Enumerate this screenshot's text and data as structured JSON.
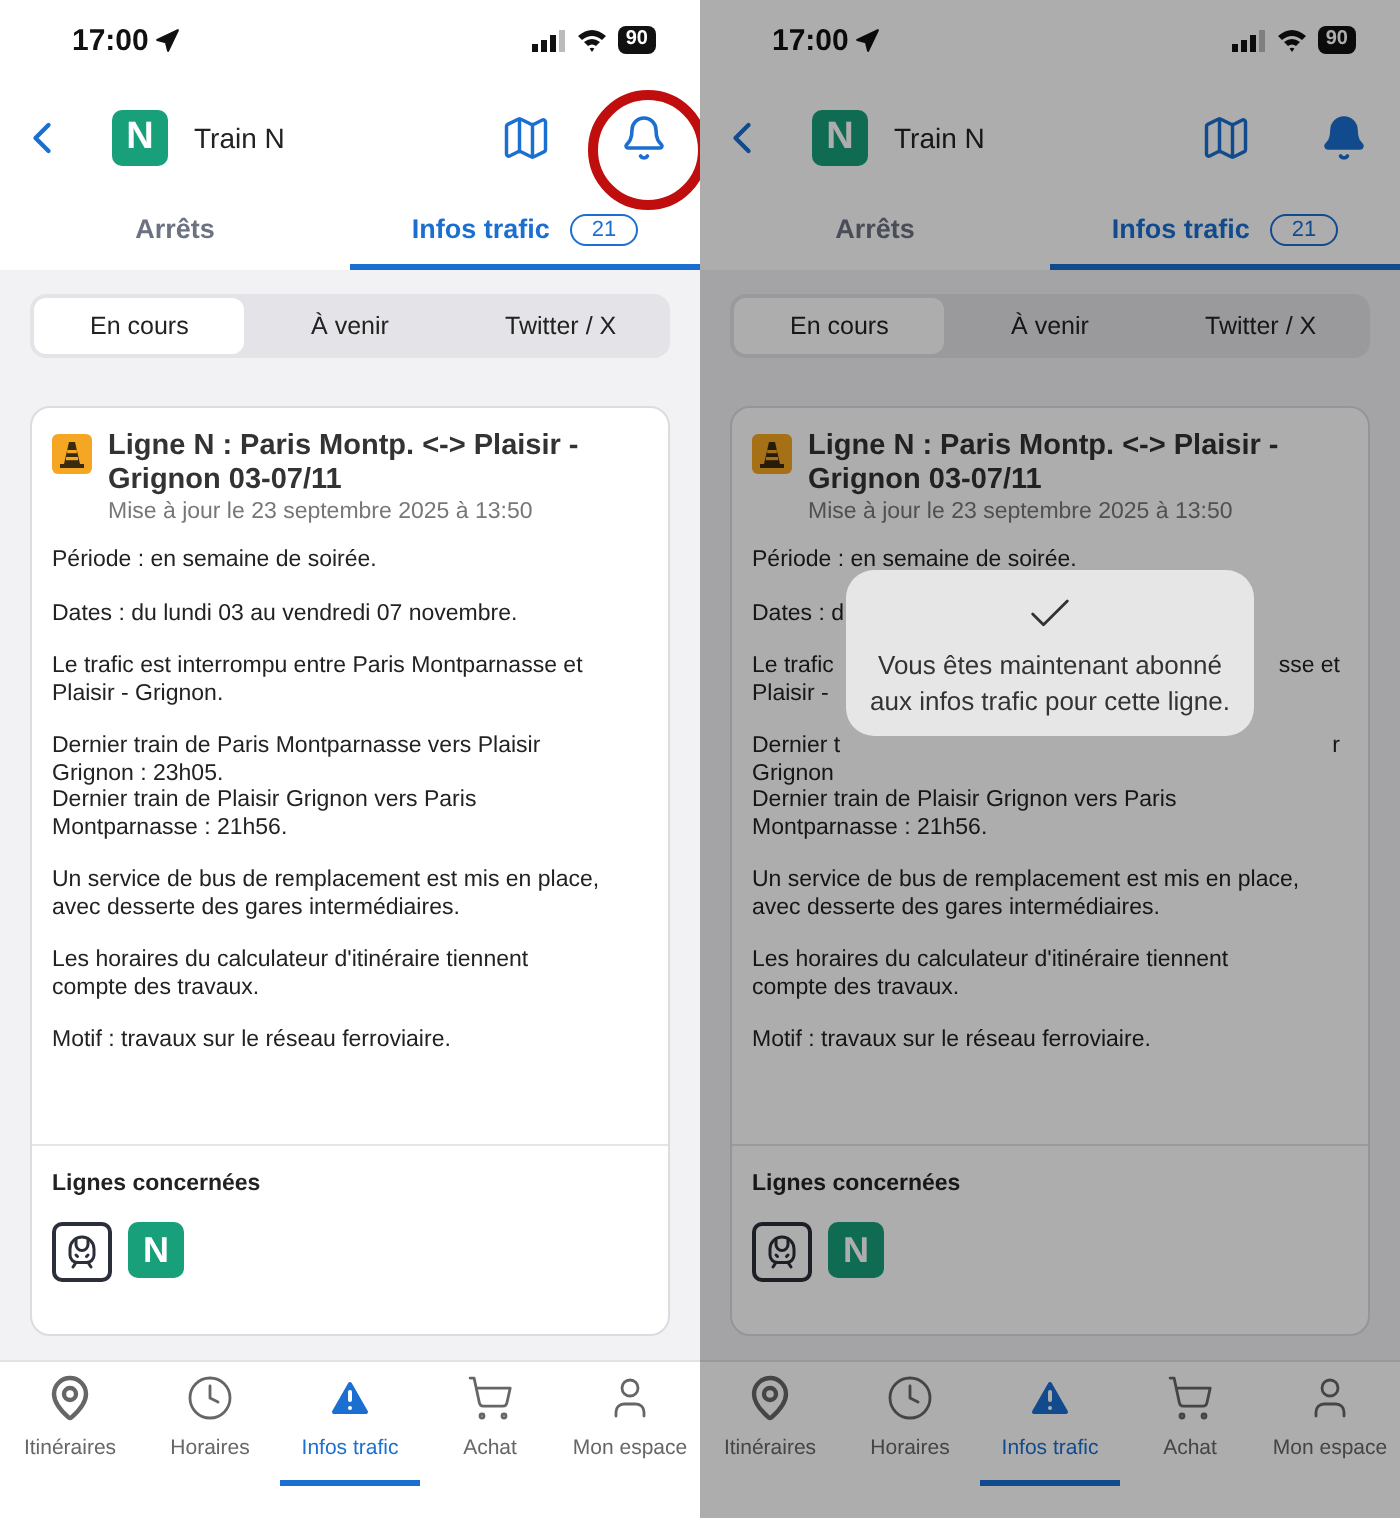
{
  "screens": [
    {
      "status_bar": {
        "time": "17:00",
        "battery": "90"
      },
      "header": {
        "line_badge": "N",
        "title": "Train N",
        "notifications_on": false,
        "highlighted": true
      },
      "tabs": [
        {
          "label": "Arrêts",
          "selected": false
        },
        {
          "label": "Infos trafic",
          "count": "21",
          "selected": true
        }
      ],
      "segments": [
        {
          "label": "En cours",
          "selected": true
        },
        {
          "label": "À venir",
          "selected": false
        },
        {
          "label": "Twitter / X",
          "selected": false
        }
      ],
      "alert": {
        "title": "Ligne N : Paris Montp. <-> Plaisir - Grignon 03-07/11",
        "updated": "Mise à jour le 23 septembre 2025 à 13:50",
        "paragraphs": [
          [
            {
              "kind": "full",
              "text": "Période : en semaine de soirée."
            }
          ],
          [
            {
              "kind": "full",
              "text": "Dates : du lundi 03 au vendredi 07 novembre."
            }
          ],
          [
            {
              "kind": "full",
              "text": "Le trafic est interrompu entre Paris Montparnasse et"
            },
            {
              "kind": "full",
              "text": "Plaisir - Grignon."
            }
          ],
          [
            {
              "kind": "full",
              "text": "Dernier train de Paris Montparnasse vers Plaisir"
            },
            {
              "kind": "full",
              "text": "Grignon : 23h05."
            },
            {
              "kind": "full",
              "text": "Dernier train de Plaisir Grignon vers Paris"
            },
            {
              "kind": "full",
              "text": "Montparnasse : 21h56."
            }
          ],
          [
            {
              "kind": "full",
              "text": "Un service de bus de remplacement est mis en place,"
            },
            {
              "kind": "full",
              "text": "avec desserte des gares intermédiaires."
            }
          ],
          [
            {
              "kind": "full",
              "text": "Les horaires du calculateur d'itinéraire tiennent"
            },
            {
              "kind": "full",
              "text": "compte des travaux."
            }
          ],
          [
            {
              "kind": "full",
              "text": "Motif : travaux sur le réseau ferroviaire."
            }
          ]
        ],
        "lines_heading": "Lignes concernées",
        "line_badges": [
          {
            "kind": "train"
          },
          {
            "kind": "line",
            "label": "N"
          }
        ]
      },
      "bottom_nav": [
        {
          "kind": "route",
          "label": "Itinéraires",
          "selected": false
        },
        {
          "kind": "clock",
          "label": "Horaires",
          "selected": false
        },
        {
          "kind": "alert",
          "label": "Infos trafic",
          "selected": true
        },
        {
          "kind": "cart",
          "label": "Achat",
          "selected": false
        },
        {
          "kind": "person",
          "label": "Mon espace",
          "selected": false
        }
      ]
    },
    {
      "status_bar": {
        "time": "17:00",
        "battery": "90"
      },
      "header": {
        "line_badge": "N",
        "title": "Train N",
        "notifications_on": true,
        "highlighted": false
      },
      "tabs": [
        {
          "label": "Arrêts",
          "selected": false
        },
        {
          "label": "Infos trafic",
          "count": "21",
          "selected": true
        }
      ],
      "segments": [
        {
          "label": "En cours",
          "selected": true
        },
        {
          "label": "À venir",
          "selected": false
        },
        {
          "label": "Twitter / X",
          "selected": false
        }
      ],
      "alert": {
        "title": "Ligne N : Paris Montp. <-> Plaisir - Grignon 03-07/11",
        "updated": "Mise à jour le 23 septembre 2025 à 13:50",
        "paragraphs": [
          [
            {
              "kind": "full",
              "text": "Période : en semaine de soirée."
            }
          ],
          [
            {
              "kind": "split",
              "left": "Dates : d"
            }
          ],
          [
            {
              "kind": "split",
              "left": "Le trafic",
              "right": "sse et"
            },
            {
              "kind": "split",
              "left": "Plaisir -"
            }
          ],
          [
            {
              "kind": "split",
              "left": "Dernier t",
              "right": "r"
            },
            {
              "kind": "full",
              "text": "Grignon"
            },
            {
              "kind": "full",
              "text": "Dernier train de Plaisir Grignon vers Paris"
            },
            {
              "kind": "full",
              "text": "Montparnasse : 21h56."
            }
          ],
          [
            {
              "kind": "full",
              "text": "Un service de bus de remplacement est mis en place,"
            },
            {
              "kind": "full",
              "text": "avec desserte des gares intermédiaires."
            }
          ],
          [
            {
              "kind": "full",
              "text": "Les horaires du calculateur d'itinéraire tiennent"
            },
            {
              "kind": "full",
              "text": "compte des travaux."
            }
          ],
          [
            {
              "kind": "full",
              "text": "Motif : travaux sur le réseau ferroviaire."
            }
          ]
        ],
        "lines_heading": "Lignes concernées",
        "line_badges": [
          {
            "kind": "train"
          },
          {
            "kind": "line",
            "label": "N"
          }
        ]
      },
      "bottom_nav": [
        {
          "kind": "route",
          "label": "Itinéraires",
          "selected": false
        },
        {
          "kind": "clock",
          "label": "Horaires",
          "selected": false
        },
        {
          "kind": "alert",
          "label": "Infos trafic",
          "selected": true
        },
        {
          "kind": "cart",
          "label": "Achat",
          "selected": false
        },
        {
          "kind": "person",
          "label": "Mon espace",
          "selected": false
        }
      ],
      "toast": {
        "message": "Vous êtes maintenant abonné aux infos trafic pour cette ligne."
      }
    }
  ]
}
